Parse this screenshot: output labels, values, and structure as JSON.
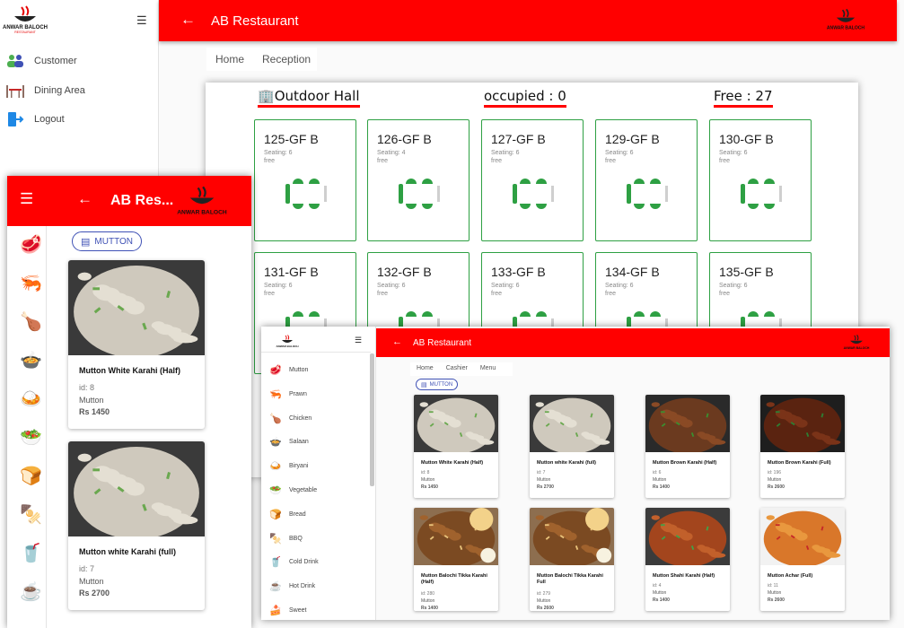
{
  "brand": {
    "logo_text": "ANWAR BALOCH",
    "logo_sub": "RESTAURANT"
  },
  "reception_app": {
    "title": "AB Restaurant",
    "sidebar": [
      {
        "label": "Customer"
      },
      {
        "label": "Dining Area"
      },
      {
        "label": "Logout"
      }
    ],
    "tabs": [
      "Home",
      "Reception"
    ],
    "hall": {
      "name": "Outdoor Hall",
      "occupied": "occupied : 0",
      "free": "Free : 27"
    },
    "tables": [
      {
        "name": "125-GF B",
        "seating": "Seating: 6",
        "status": "free"
      },
      {
        "name": "126-GF B",
        "seating": "Seating: 4",
        "status": "free"
      },
      {
        "name": "127-GF B",
        "seating": "Seating: 6",
        "status": "free"
      },
      {
        "name": "129-GF B",
        "seating": "Seating: 6",
        "status": "free"
      },
      {
        "name": "130-GF B",
        "seating": "Seating: 6",
        "status": "free"
      },
      {
        "name": "131-GF B",
        "seating": "Seating: 6",
        "status": "free"
      },
      {
        "name": "132-GF B",
        "seating": "Seating: 6",
        "status": "free"
      },
      {
        "name": "133-GF B",
        "seating": "Seating: 6",
        "status": "free"
      },
      {
        "name": "134-GF B",
        "seating": "Seating: 6",
        "status": "free"
      },
      {
        "name": "135-GF B",
        "seating": "Seating: 6",
        "status": "free"
      }
    ]
  },
  "mobile_app": {
    "title": "AB Res...",
    "category_chip": "MUTTON",
    "products": [
      {
        "name": "Mutton White Karahi (Half)",
        "id": "id: 8",
        "category": "Mutton",
        "price": "Rs 1450"
      },
      {
        "name": "Mutton white Karahi (full)",
        "id": "id: 7",
        "category": "Mutton",
        "price": "Rs 2700"
      }
    ],
    "rail_icons": [
      "meat-icon",
      "prawn-icon",
      "chicken-icon",
      "salaan-icon",
      "biryani-icon",
      "vegetable-icon",
      "bread-icon",
      "bbq-icon",
      "cold-drink-icon",
      "hot-drink-icon"
    ]
  },
  "menu_app": {
    "title": "AB Restaurant",
    "tabs": [
      "Home",
      "Cashier",
      "Menu"
    ],
    "category_chip": "MUTTON",
    "sidebar": [
      {
        "label": "Mutton",
        "icon": "mutton-icon"
      },
      {
        "label": "Prawn",
        "icon": "prawn-icon"
      },
      {
        "label": "Chicken",
        "icon": "chicken-icon"
      },
      {
        "label": "Salaan",
        "icon": "salaan-icon"
      },
      {
        "label": "Biryani",
        "icon": "biryani-icon"
      },
      {
        "label": "Vegetable",
        "icon": "vegetable-icon"
      },
      {
        "label": "Bread",
        "icon": "bread-icon"
      },
      {
        "label": "BBQ",
        "icon": "bbq-icon"
      },
      {
        "label": "Cold Drink",
        "icon": "cold-drink-icon"
      },
      {
        "label": "Hot Drink",
        "icon": "hot-drink-icon"
      },
      {
        "label": "Sweet",
        "icon": "sweet-icon"
      }
    ],
    "products": [
      {
        "name": "Mutton White Karahi (Half)",
        "id": "id: 8",
        "category": "Mutton",
        "price": "Rs 1450"
      },
      {
        "name": "Mutton white Karahi (full)",
        "id": "id: 7",
        "category": "Mutton",
        "price": "Rs 2700"
      },
      {
        "name": "Mutton Brown Karahi (Half)",
        "id": "id: 6",
        "category": "Mutton",
        "price": "Rs 1400"
      },
      {
        "name": "Mutton Brown Karahi (Full)",
        "id": "id: 196",
        "category": "Mutton",
        "price": "Rs 2600"
      },
      {
        "name": "Mutton Balochi Tikka Karahi (Half)",
        "id": "id: 280",
        "category": "Mutton",
        "price": "Rs 1400"
      },
      {
        "name": "Mutton Balochi Tikka Karahi Full",
        "id": "id: 279",
        "category": "Mutton",
        "price": "Rs 2600"
      },
      {
        "name": "Mutton Shahi Karahi (Half)",
        "id": "id: 4",
        "category": "Mutton",
        "price": "Rs 1400"
      },
      {
        "name": "Mutton Achar (Full)",
        "id": "id: 11",
        "category": "Mutton",
        "price": "Rs 2600"
      }
    ]
  },
  "colors": {
    "header": "#ff0000",
    "table_free": "#2ea043",
    "chip": "#3f51b5"
  }
}
